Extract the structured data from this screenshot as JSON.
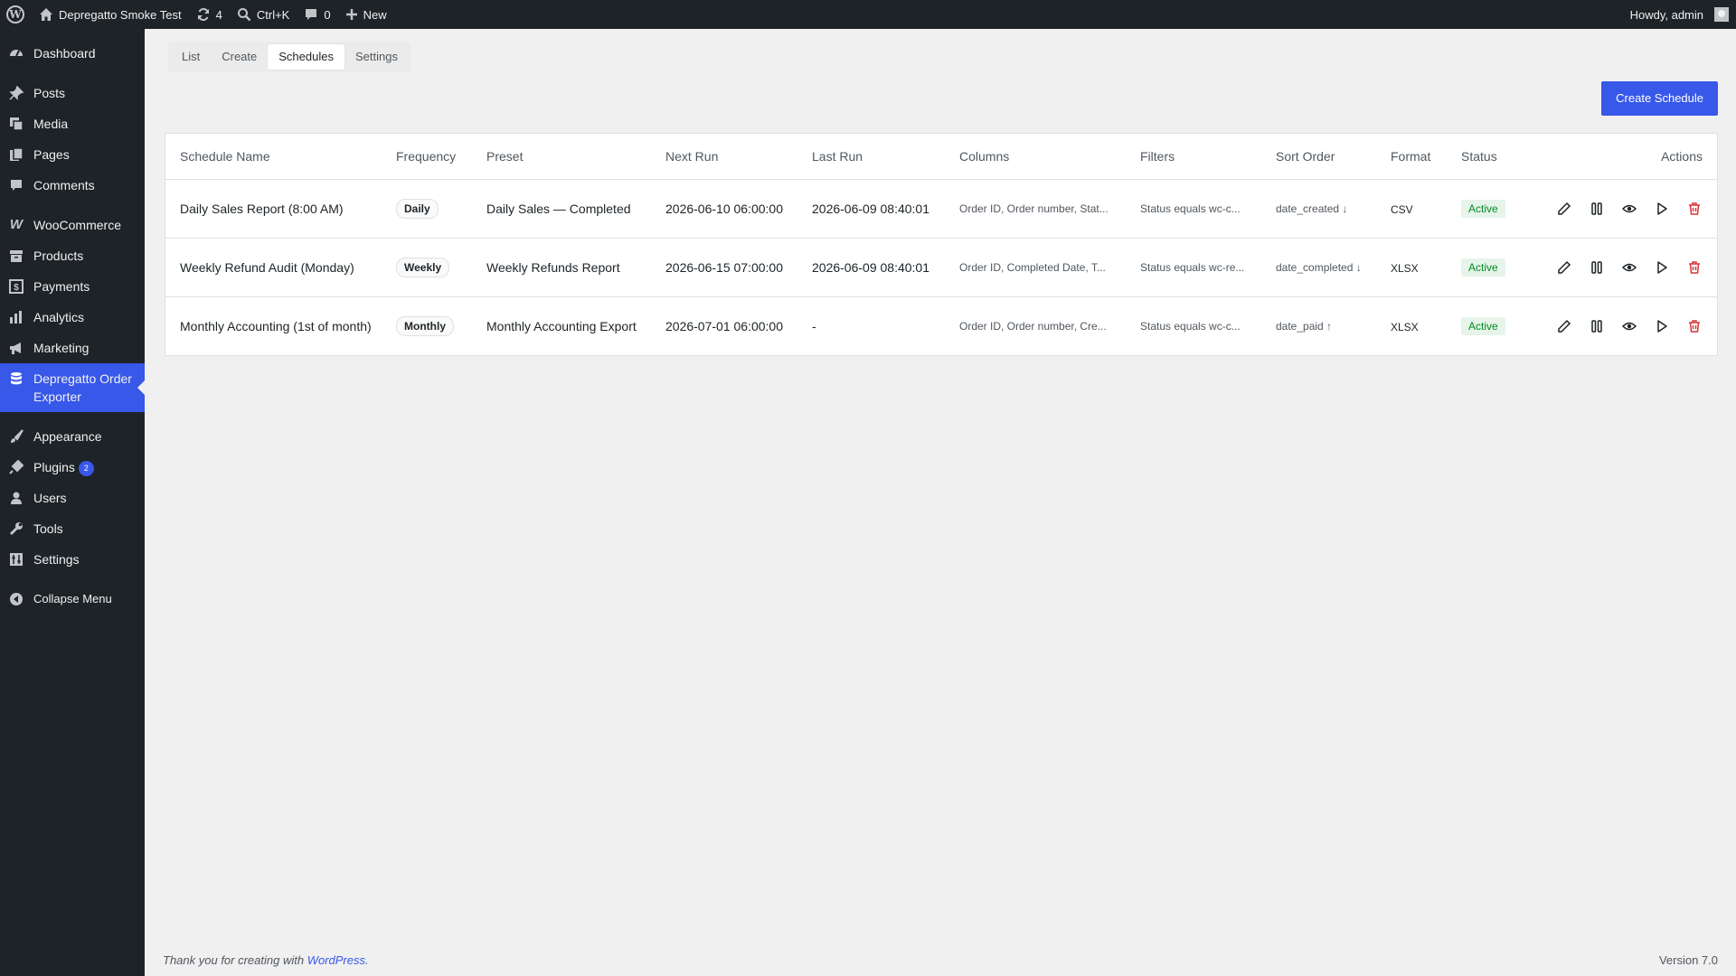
{
  "adminbar": {
    "site_name": "Depregatto Smoke Test",
    "updates_count": "4",
    "search_shortcut": "Ctrl+K",
    "comments_count": "0",
    "new_label": "New",
    "howdy": "Howdy, admin"
  },
  "sidebar": {
    "items": [
      {
        "label": "Dashboard"
      },
      {
        "label": "Posts"
      },
      {
        "label": "Media"
      },
      {
        "label": "Pages"
      },
      {
        "label": "Comments"
      },
      {
        "label": "WooCommerce"
      },
      {
        "label": "Products"
      },
      {
        "label": "Payments"
      },
      {
        "label": "Analytics"
      },
      {
        "label": "Marketing"
      },
      {
        "label": "Depregatto Order Exporter"
      },
      {
        "label": "Appearance"
      },
      {
        "label": "Plugins",
        "badge": "2"
      },
      {
        "label": "Users"
      },
      {
        "label": "Tools"
      },
      {
        "label": "Settings"
      }
    ],
    "collapse_label": "Collapse Menu"
  },
  "tabs": [
    "List",
    "Create",
    "Schedules",
    "Settings"
  ],
  "active_tab": "Schedules",
  "create_button": "Create Schedule",
  "table": {
    "headers": [
      "Schedule Name",
      "Frequency",
      "Preset",
      "Next Run",
      "Last Run",
      "Columns",
      "Filters",
      "Sort Order",
      "Format",
      "Status",
      "Actions"
    ],
    "rows": [
      {
        "name": "Daily Sales Report (8:00 AM)",
        "frequency": "Daily",
        "preset": "Daily Sales — Completed",
        "next_run": "2026-06-10 06:00:00",
        "last_run": "2026-06-09 08:40:01",
        "columns": "Order ID, Order number, Stat...",
        "filters": "Status equals wc-c...",
        "sort": "date_created ↓",
        "format": "CSV",
        "status": "Active"
      },
      {
        "name": "Weekly Refund Audit (Monday)",
        "frequency": "Weekly",
        "preset": "Weekly Refunds Report",
        "next_run": "2026-06-15 07:00:00",
        "last_run": "2026-06-09 08:40:01",
        "columns": "Order ID, Completed Date, T...",
        "filters": "Status equals wc-re...",
        "sort": "date_completed ↓",
        "format": "XLSX",
        "status": "Active"
      },
      {
        "name": "Monthly Accounting (1st of month)",
        "frequency": "Monthly",
        "preset": "Monthly Accounting Export",
        "next_run": "2026-07-01 06:00:00",
        "last_run": "-",
        "columns": "Order ID, Order number, Cre...",
        "filters": "Status equals wc-c...",
        "sort": "date_paid ↑",
        "format": "XLSX",
        "status": "Active"
      }
    ]
  },
  "footer": {
    "thanks_prefix": "Thank you for creating with ",
    "thanks_link": "WordPress",
    "thanks_suffix": ".",
    "version": "Version 7.0"
  },
  "colors": {
    "accent": "#3858e9",
    "sidebar_bg": "#1d2327",
    "status_active": "#008a20",
    "delete_icon": "#d63638"
  }
}
